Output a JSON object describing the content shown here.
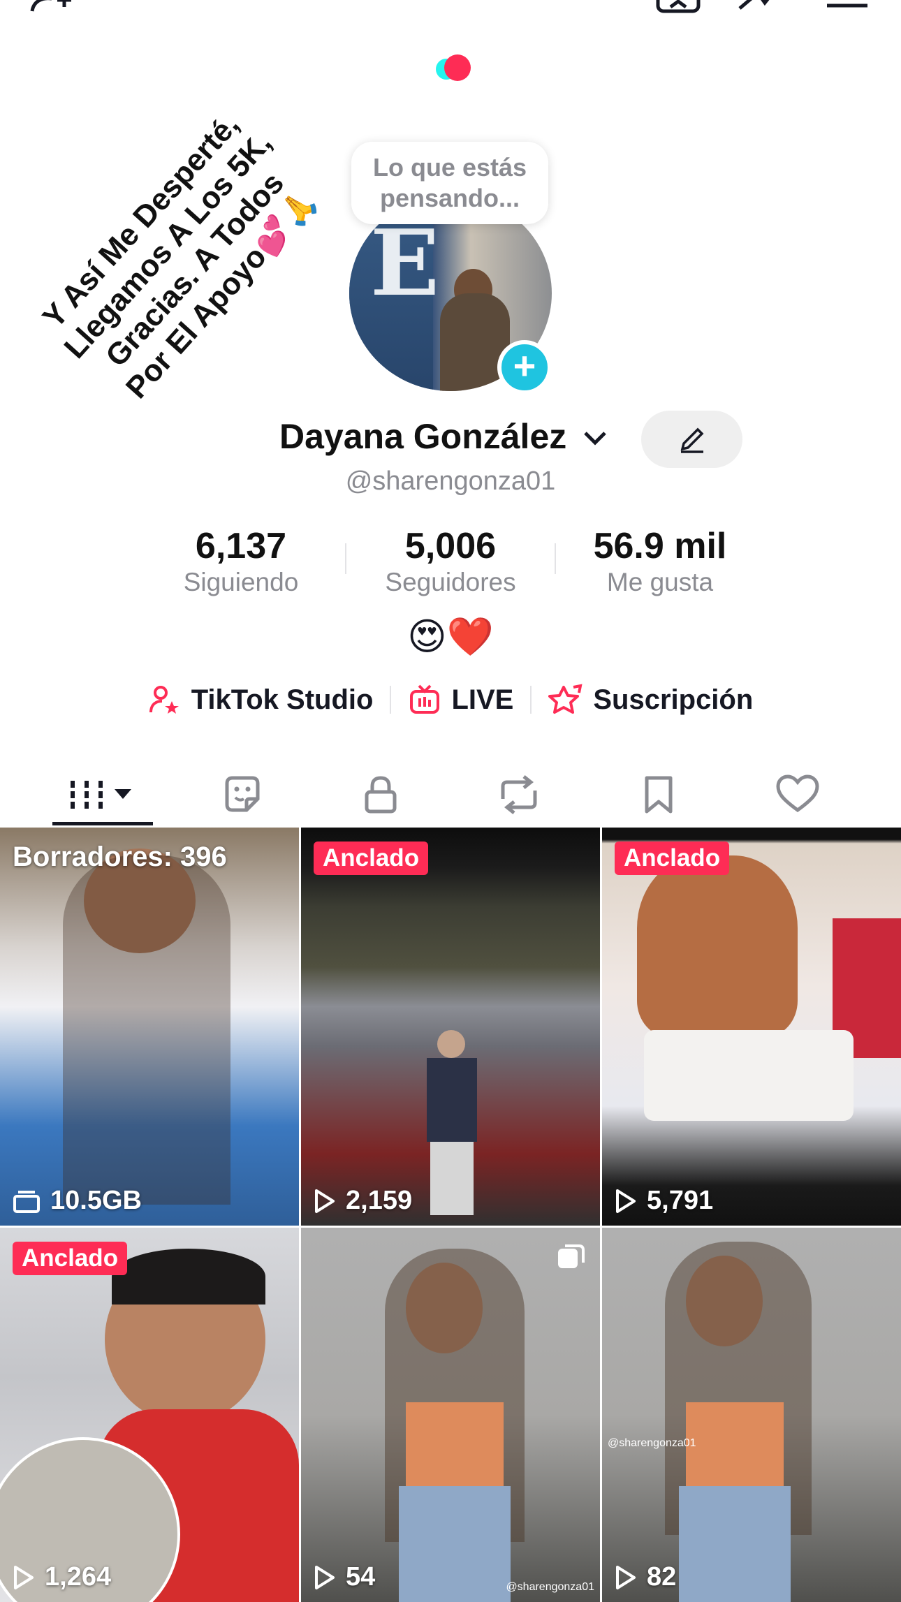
{
  "profile": {
    "bubble_text": "Lo que estás pensando...",
    "caption": "Y Así Me Desperté, Llegamos A Los 5K, Gracias. A Todos Por El Apoyo💕🙏",
    "display_name": "Dayana González",
    "handle": "@sharengonza01",
    "bio_emoji": "😍❤️"
  },
  "stats": [
    {
      "value": "6,137",
      "label": "Siguiendo"
    },
    {
      "value": "5,006",
      "label": "Seguidores"
    },
    {
      "value": "56.9 mil",
      "label": "Me gusta"
    }
  ],
  "links": [
    {
      "label": "TikTok Studio",
      "icon": "person-star-icon"
    },
    {
      "label": "LIVE",
      "icon": "tv-icon"
    },
    {
      "label": "Suscripción",
      "icon": "star-badge-icon"
    }
  ],
  "tabs": [
    "videos-grid-icon",
    "sticker-icon",
    "lock-icon",
    "repost-icon",
    "bookmark-icon",
    "heart-icon"
  ],
  "grid": [
    {
      "overlay": "Borradores: 396",
      "count": "10.5GB",
      "pinned": false,
      "drafts": true
    },
    {
      "badge": "Anclado",
      "count": "2,159",
      "pinned": true
    },
    {
      "badge": "Anclado",
      "count": "5,791",
      "pinned": true
    },
    {
      "badge": "Anclado",
      "count": "1,264",
      "pinned": true
    },
    {
      "count": "54",
      "pinned": false,
      "watermark": "@sharengonza01"
    },
    {
      "count": "82",
      "pinned": false,
      "watermark": "@sharengonza01"
    }
  ],
  "colors": {
    "accent": "#fe2c55",
    "cyan": "#1fc4e0"
  }
}
